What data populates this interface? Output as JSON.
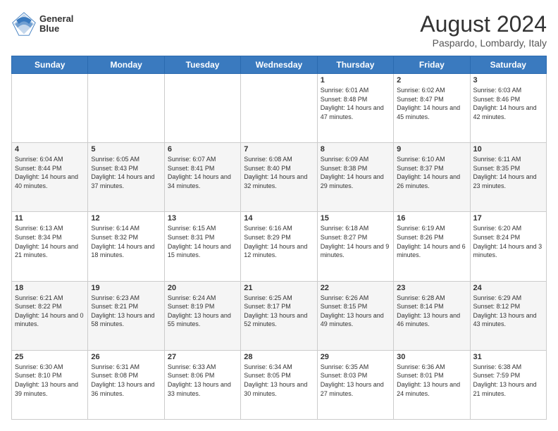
{
  "header": {
    "logo_line1": "General",
    "logo_line2": "Blue",
    "month_title": "August 2024",
    "location": "Paspardo, Lombardy, Italy"
  },
  "days_of_week": [
    "Sunday",
    "Monday",
    "Tuesday",
    "Wednesday",
    "Thursday",
    "Friday",
    "Saturday"
  ],
  "weeks": [
    [
      {
        "day": "",
        "info": ""
      },
      {
        "day": "",
        "info": ""
      },
      {
        "day": "",
        "info": ""
      },
      {
        "day": "",
        "info": ""
      },
      {
        "day": "1",
        "info": "Sunrise: 6:01 AM\nSunset: 8:48 PM\nDaylight: 14 hours\nand 47 minutes."
      },
      {
        "day": "2",
        "info": "Sunrise: 6:02 AM\nSunset: 8:47 PM\nDaylight: 14 hours\nand 45 minutes."
      },
      {
        "day": "3",
        "info": "Sunrise: 6:03 AM\nSunset: 8:46 PM\nDaylight: 14 hours\nand 42 minutes."
      }
    ],
    [
      {
        "day": "4",
        "info": "Sunrise: 6:04 AM\nSunset: 8:44 PM\nDaylight: 14 hours\nand 40 minutes."
      },
      {
        "day": "5",
        "info": "Sunrise: 6:05 AM\nSunset: 8:43 PM\nDaylight: 14 hours\nand 37 minutes."
      },
      {
        "day": "6",
        "info": "Sunrise: 6:07 AM\nSunset: 8:41 PM\nDaylight: 14 hours\nand 34 minutes."
      },
      {
        "day": "7",
        "info": "Sunrise: 6:08 AM\nSunset: 8:40 PM\nDaylight: 14 hours\nand 32 minutes."
      },
      {
        "day": "8",
        "info": "Sunrise: 6:09 AM\nSunset: 8:38 PM\nDaylight: 14 hours\nand 29 minutes."
      },
      {
        "day": "9",
        "info": "Sunrise: 6:10 AM\nSunset: 8:37 PM\nDaylight: 14 hours\nand 26 minutes."
      },
      {
        "day": "10",
        "info": "Sunrise: 6:11 AM\nSunset: 8:35 PM\nDaylight: 14 hours\nand 23 minutes."
      }
    ],
    [
      {
        "day": "11",
        "info": "Sunrise: 6:13 AM\nSunset: 8:34 PM\nDaylight: 14 hours\nand 21 minutes."
      },
      {
        "day": "12",
        "info": "Sunrise: 6:14 AM\nSunset: 8:32 PM\nDaylight: 14 hours\nand 18 minutes."
      },
      {
        "day": "13",
        "info": "Sunrise: 6:15 AM\nSunset: 8:31 PM\nDaylight: 14 hours\nand 15 minutes."
      },
      {
        "day": "14",
        "info": "Sunrise: 6:16 AM\nSunset: 8:29 PM\nDaylight: 14 hours\nand 12 minutes."
      },
      {
        "day": "15",
        "info": "Sunrise: 6:18 AM\nSunset: 8:27 PM\nDaylight: 14 hours\nand 9 minutes."
      },
      {
        "day": "16",
        "info": "Sunrise: 6:19 AM\nSunset: 8:26 PM\nDaylight: 14 hours\nand 6 minutes."
      },
      {
        "day": "17",
        "info": "Sunrise: 6:20 AM\nSunset: 8:24 PM\nDaylight: 14 hours\nand 3 minutes."
      }
    ],
    [
      {
        "day": "18",
        "info": "Sunrise: 6:21 AM\nSunset: 8:22 PM\nDaylight: 14 hours\nand 0 minutes."
      },
      {
        "day": "19",
        "info": "Sunrise: 6:23 AM\nSunset: 8:21 PM\nDaylight: 13 hours\nand 58 minutes."
      },
      {
        "day": "20",
        "info": "Sunrise: 6:24 AM\nSunset: 8:19 PM\nDaylight: 13 hours\nand 55 minutes."
      },
      {
        "day": "21",
        "info": "Sunrise: 6:25 AM\nSunset: 8:17 PM\nDaylight: 13 hours\nand 52 minutes."
      },
      {
        "day": "22",
        "info": "Sunrise: 6:26 AM\nSunset: 8:15 PM\nDaylight: 13 hours\nand 49 minutes."
      },
      {
        "day": "23",
        "info": "Sunrise: 6:28 AM\nSunset: 8:14 PM\nDaylight: 13 hours\nand 46 minutes."
      },
      {
        "day": "24",
        "info": "Sunrise: 6:29 AM\nSunset: 8:12 PM\nDaylight: 13 hours\nand 43 minutes."
      }
    ],
    [
      {
        "day": "25",
        "info": "Sunrise: 6:30 AM\nSunset: 8:10 PM\nDaylight: 13 hours\nand 39 minutes."
      },
      {
        "day": "26",
        "info": "Sunrise: 6:31 AM\nSunset: 8:08 PM\nDaylight: 13 hours\nand 36 minutes."
      },
      {
        "day": "27",
        "info": "Sunrise: 6:33 AM\nSunset: 8:06 PM\nDaylight: 13 hours\nand 33 minutes."
      },
      {
        "day": "28",
        "info": "Sunrise: 6:34 AM\nSunset: 8:05 PM\nDaylight: 13 hours\nand 30 minutes."
      },
      {
        "day": "29",
        "info": "Sunrise: 6:35 AM\nSunset: 8:03 PM\nDaylight: 13 hours\nand 27 minutes."
      },
      {
        "day": "30",
        "info": "Sunrise: 6:36 AM\nSunset: 8:01 PM\nDaylight: 13 hours\nand 24 minutes."
      },
      {
        "day": "31",
        "info": "Sunrise: 6:38 AM\nSunset: 7:59 PM\nDaylight: 13 hours\nand 21 minutes."
      }
    ]
  ]
}
